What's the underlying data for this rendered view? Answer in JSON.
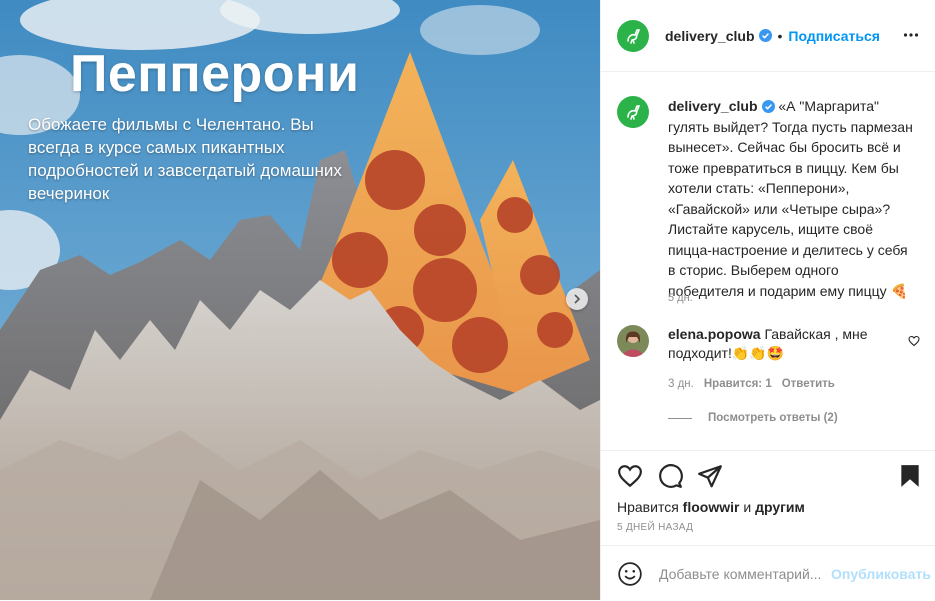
{
  "post": {
    "image": {
      "headline": "Пепперони",
      "subtitle": "Обожаете фильмы с Челентано. Вы всегда в курсе самых пикантных подробностей и завсегдатый домашних вечеринок"
    },
    "author": {
      "username": "delivery_club",
      "follow_label": "Подписаться",
      "dot": "•",
      "avatar_color": "#2bb34a"
    },
    "caption": {
      "username": "delivery_club",
      "text": "«А \"Маргарита\" гулять выйдет? Тогда пусть пармезан вынесет». Сейчас бы бросить всё и тоже превратиться в пиццу. Кем бы хотели стать: «Пепперони», «Гавайской» или «Четыре сыра»? Листайте карусель, ищите своё пицца-настроение и делитесь у себя в сторис. Выберем одного победителя и подарим ему пиццу 🍕",
      "time": "5 дн."
    },
    "comment": {
      "username": "elena.popowa",
      "text": "Гавайская , мне подходит!👏👏🤩",
      "time": "3 дн.",
      "likes": "Нравится: 1",
      "reply_label": "Ответить",
      "view_replies": "Посмотреть ответы (2)"
    },
    "likes": {
      "prefix": "Нравится",
      "user": "floowwir",
      "middle": "и",
      "others": "другим"
    },
    "posted_ago": "5 ДНЕЙ НАЗАД",
    "composer": {
      "placeholder": "Добавьте комментарий...",
      "publish_label": "Опубликовать"
    },
    "colors": {
      "accent": "#0095f6",
      "publish_disabled": "#b2dffc",
      "secondary_text": "#8e8e8e"
    }
  }
}
